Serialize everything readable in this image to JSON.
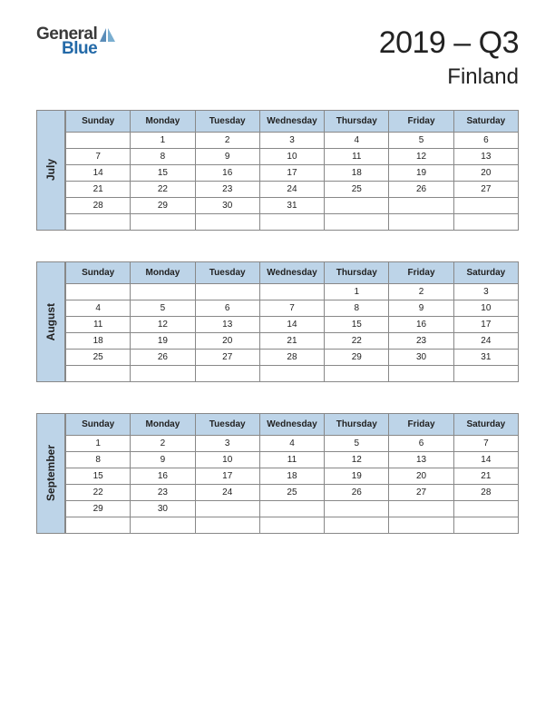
{
  "logo": {
    "line1": "General",
    "line2": "Blue"
  },
  "title": {
    "main": "2019 – Q3",
    "sub": "Finland"
  },
  "day_headers": [
    "Sunday",
    "Monday",
    "Tuesday",
    "Wednesday",
    "Thursday",
    "Friday",
    "Saturday"
  ],
  "months": [
    {
      "name": "July",
      "weeks": [
        [
          "",
          "1",
          "2",
          "3",
          "4",
          "5",
          "6"
        ],
        [
          "7",
          "8",
          "9",
          "10",
          "11",
          "12",
          "13"
        ],
        [
          "14",
          "15",
          "16",
          "17",
          "18",
          "19",
          "20"
        ],
        [
          "21",
          "22",
          "23",
          "24",
          "25",
          "26",
          "27"
        ],
        [
          "28",
          "29",
          "30",
          "31",
          "",
          "",
          ""
        ],
        [
          "",
          "",
          "",
          "",
          "",
          "",
          ""
        ]
      ]
    },
    {
      "name": "August",
      "weeks": [
        [
          "",
          "",
          "",
          "",
          "1",
          "2",
          "3"
        ],
        [
          "4",
          "5",
          "6",
          "7",
          "8",
          "9",
          "10"
        ],
        [
          "11",
          "12",
          "13",
          "14",
          "15",
          "16",
          "17"
        ],
        [
          "18",
          "19",
          "20",
          "21",
          "22",
          "23",
          "24"
        ],
        [
          "25",
          "26",
          "27",
          "28",
          "29",
          "30",
          "31"
        ],
        [
          "",
          "",
          "",
          "",
          "",
          "",
          ""
        ]
      ]
    },
    {
      "name": "September",
      "weeks": [
        [
          "1",
          "2",
          "3",
          "4",
          "5",
          "6",
          "7"
        ],
        [
          "8",
          "9",
          "10",
          "11",
          "12",
          "13",
          "14"
        ],
        [
          "15",
          "16",
          "17",
          "18",
          "19",
          "20",
          "21"
        ],
        [
          "22",
          "23",
          "24",
          "25",
          "26",
          "27",
          "28"
        ],
        [
          "29",
          "30",
          "",
          "",
          "",
          "",
          ""
        ],
        [
          "",
          "",
          "",
          "",
          "",
          "",
          ""
        ]
      ]
    }
  ]
}
